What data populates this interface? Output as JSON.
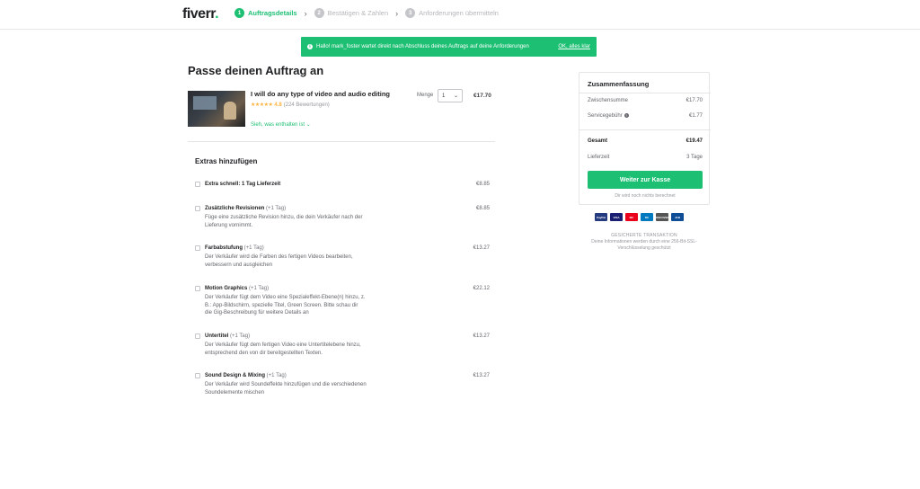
{
  "header": {
    "logo": "fiverr",
    "logo_dot": ".",
    "steps": [
      {
        "num": "1",
        "label": "Auftragsdetails"
      },
      {
        "num": "2",
        "label": "Bestätigen & Zahlen"
      },
      {
        "num": "3",
        "label": "Anforderungen übermitteln"
      }
    ]
  },
  "toast": {
    "message": "Hallo! mark_foster wartet direkt nach Abschluss deines Auftrags auf deine Anforderungen",
    "ok_label": "OK, alles klar",
    "info_icon": "i"
  },
  "main": {
    "title": "Passe deinen Auftrag an",
    "gig": {
      "title": "I will do any type of video and audio editing",
      "stars": "★★★★★",
      "rating": "4.8",
      "reviews": "(224 Bewertungen)",
      "see_included": "Sieh, was enthalten ist ⌄",
      "quantity_label": "Menge",
      "quantity": "1",
      "price": "€17.70"
    },
    "extras_title": "Extras hinzufügen",
    "extras": [
      {
        "name": "Extra schnell: 1 Tag Lieferzeit",
        "tag": "",
        "desc": "",
        "price": "€8.85"
      },
      {
        "name": "Zusätzliche Revisionen",
        "tag": "(+1 Tag)",
        "desc": "Füge eine zusätzliche Revision hinzu, die dein Verkäufer nach der Lieferung vornimmt.",
        "price": "€8.85"
      },
      {
        "name": "Farbabstufung",
        "tag": "(+1 Tag)",
        "desc": "Der Verkäufer wird die Farben des fertigen Videos bearbeiten, verbessern und ausgleichen",
        "price": "€13.27"
      },
      {
        "name": "Motion Graphics",
        "tag": "(+1 Tag)",
        "desc": "Der Verkäufer fügt dem Video eine Spezialeffekt-Ebene(n) hinzu, z. B.: App-Bildschirm, spezielle Titel, Green Screen. Bitte schau dir die Gig-Beschreibung für weitere Details an",
        "price": "€22.12"
      },
      {
        "name": "Untertitel",
        "tag": "(+1 Tag)",
        "desc": "Der Verkäufer fügt dem fertigen Video eine Untertitelebene hinzu, entsprechend den von dir bereitgestellten Texten.",
        "price": "€13.27"
      },
      {
        "name": "Sound Design & Mixing",
        "tag": "(+1 Tag)",
        "desc": "Der Verkäufer wird Soundeffekte hinzufügen und die verschiedenen Soundelemente mischen",
        "price": "€13.27"
      }
    ]
  },
  "summary": {
    "title": "Zusammenfassung",
    "subtotal_label": "Zwischensumme",
    "subtotal": "€17.70",
    "service_fee_label": "Servicegebühr",
    "service_fee": "€1.77",
    "total_label": "Gesamt",
    "total": "€19.47",
    "delivery_label": "Lieferzeit",
    "delivery": "3 Tage",
    "checkout_label": "Weiter zur Kasse",
    "note": "Dir wird noch nichts berechnet",
    "help_icon": "?"
  },
  "payments": [
    {
      "name": "PayPal",
      "color": "#253b80"
    },
    {
      "name": "VISA",
      "color": "#1a1f71"
    },
    {
      "name": "MC",
      "color": "#eb001b"
    },
    {
      "name": "DC",
      "color": "#0079be"
    },
    {
      "name": "DISCOVER",
      "color": "#555555"
    },
    {
      "name": "JCB",
      "color": "#0e4c96"
    }
  ],
  "secure": {
    "title": "GESICHERTE TRANSAKTION",
    "text": "Deine Informationen werden durch eine 256-Bit-SSL-Verschlüsselung geschützt"
  },
  "colors": {
    "accent": "#1dbf73",
    "text": "#404145",
    "muted": "#95979d"
  }
}
